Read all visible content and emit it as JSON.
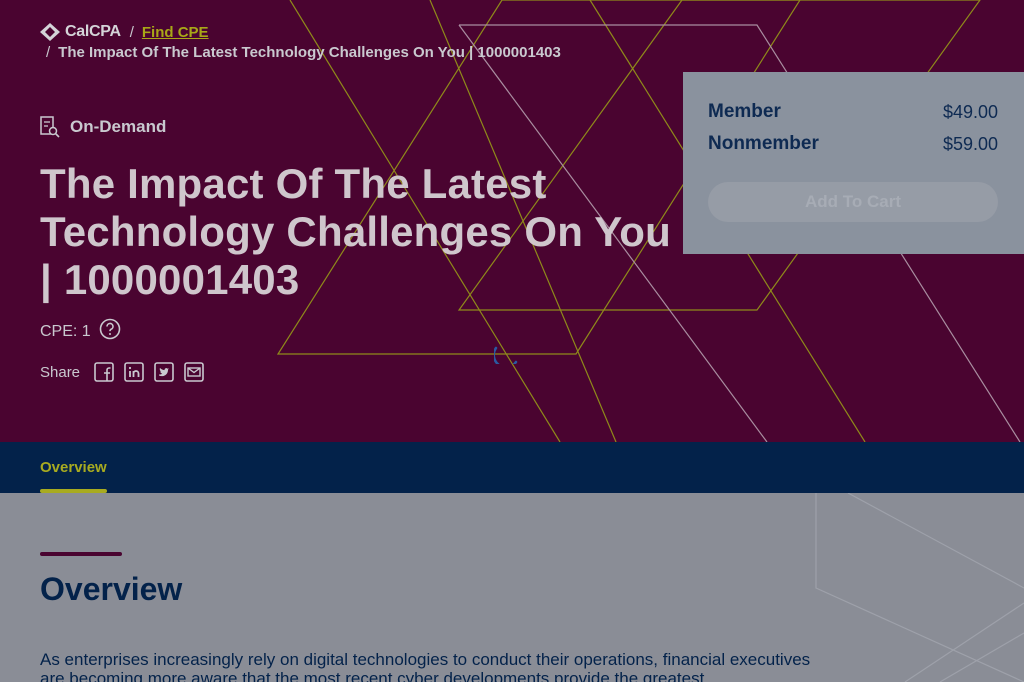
{
  "breadcrumb": {
    "logo_text": "CalCPA",
    "separator": "/",
    "link": "Find CPE",
    "current": "The Impact Of The Latest Technology Challenges On You | 1000001403"
  },
  "course": {
    "format": "On-Demand",
    "title": "The Impact Of The Latest Technology Challenges On You | 1000001403",
    "cpe": "CPE: 1",
    "share_label": "Share"
  },
  "pricing": {
    "member_label": "Member",
    "member_price": "$49.00",
    "nonmember_label": "Nonmember",
    "nonmember_price": "$59.00",
    "cart_button": "Add To Cart"
  },
  "tabs": [
    {
      "label": "Overview",
      "active": true
    }
  ],
  "overview": {
    "heading": "Overview",
    "body": "As enterprises increasingly rely on digital technologies to conduct their operations, financial executives are becoming more aware that the most recent cyber developments provide the greatest"
  },
  "icons": {
    "format": "document-search-icon",
    "help": "question-circle-icon",
    "share": [
      "facebook-icon",
      "linkedin-icon",
      "twitter-icon",
      "email-icon"
    ]
  },
  "colors": {
    "hero_bg": "#4a0430",
    "accent": "#a8ab20",
    "navy": "#03224a",
    "overlay_content": "#8a8d96"
  }
}
